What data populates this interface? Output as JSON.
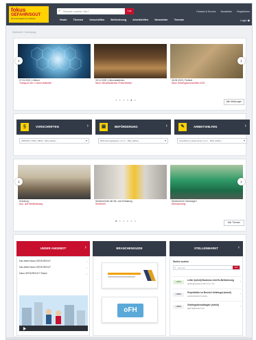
{
  "header": {
    "logo_line1": "fokus",
    "logo_line2": "GEFAHR/SGUT",
    "logo_tagline": "Das Fachmagazin für Gefahrgut",
    "search_placeholder": "Wonach suchen Sie?",
    "search_button": "Los",
    "top_links": [
      "Hinweis & Service",
      "Newsletter",
      "Registrieren"
    ],
    "nav": [
      "Heute",
      "Themen",
      "Vorschriften",
      "Beförderung",
      "Arbeitshilfen",
      "Newsletter",
      "Termine"
    ],
    "login": "Login",
    "brand_color": "#ffd200",
    "accent_color": "#c8102e",
    "dark_color": "#39414f"
  },
  "breadcrumb": "Startseite  /  Homepage",
  "slider1": {
    "slides": [
      {
        "caption": "27.01.2021 | Lithium",
        "caption2": "Transport von Li-Ionen-Batterien"
      },
      {
        "caption": "30.11.2020 | Lithiumbatterien",
        "caption2": "Neue Lithiumbatterien-Prüfverfahren"
      },
      {
        "caption": "26.05.2021 | Freitext",
        "caption2": "Neue Gefahrgutvorschriften 2021"
      }
    ],
    "more_button": "Alle Meldungen",
    "dot_count": 6,
    "active_dot": 5
  },
  "categories": [
    {
      "title": "VORSCHRIFTEN",
      "icon": "book-icon",
      "select": "ADR/RID | DGR | IMDG - Bitte wählen"
    },
    {
      "title": "BEFÖRDERUNG",
      "icon": "truck-icon",
      "select": "Beförderungspapiere u.a.m. - Bitte wählen"
    },
    {
      "title": "ARBEITSHILFEN",
      "icon": "tools-icon",
      "select": "Checklisten | Dokumente u.a.m. - Bitte wählen"
    }
  ],
  "slider2": {
    "slides": [
      {
        "caption": "Schulung",
        "caption2": "Aus- und Weiterbildung"
      },
      {
        "caption": "Sicherheit bei der Be- und Entladung",
        "caption2": "Sicherheit"
      },
      {
        "caption": "Sicherheit im Tankwagen",
        "caption2": "Überwachung"
      }
    ],
    "more_button": "Alle Themen",
    "dot_count": 6,
    "active_dot": 1
  },
  "columns": {
    "offer": {
      "title": "UNSER ANGEBOT",
      "links": [
        "Das bietet fokus GEFAHR/GUT",
        "Das bietet fokus GEFAHR/GUT",
        "fokus GEFAHR/GUT Testen"
      ]
    },
    "guide": {
      "title": "BRANCHENGUIDE"
    },
    "jobs": {
      "title": "STELLENMARKT",
      "search_label": "Stellen suchen",
      "search_placeholder": "Wonach",
      "search_button": "Los",
      "items": [
        {
          "logo": "LOGO",
          "title": "Leiter (m/w/d) Business Unit Ex-Beförderung",
          "sub": "gefahrgutsysteme BC & Co. KG"
        },
        {
          "logo": "LOGO",
          "title": "Projektleiter im Bereich Gefahrgut (m/w/d)",
          "sub": "Landesbetrieb Freiburg"
        },
        {
          "logo": "LOGO",
          "title": "Gefahrgutbeauftragter (m/w/d)",
          "sub": "RETTERSTADT AG"
        }
      ]
    }
  }
}
